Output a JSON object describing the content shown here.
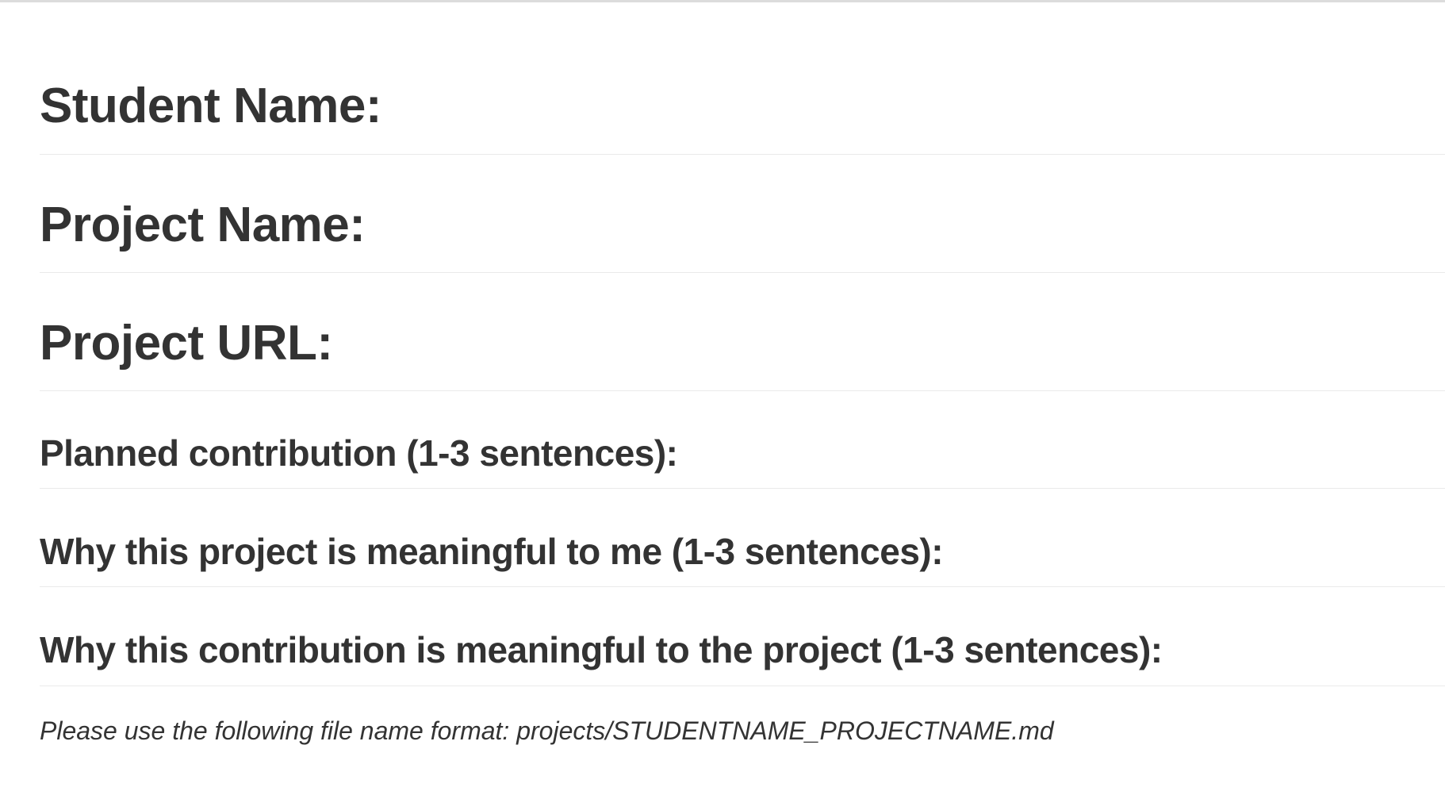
{
  "document": {
    "headings": {
      "student_name": "Student Name:",
      "project_name": "Project Name:",
      "project_url": "Project URL:",
      "planned_contribution": "Planned contribution (1-3 sentences):",
      "why_meaningful_to_me": "Why this project is meaningful to me (1-3 sentences):",
      "why_meaningful_to_project": "Why this contribution is meaningful to the project (1-3 sentences):"
    },
    "note": "Please use the following file name format: projects/STUDENTNAME_PROJECTNAME.md"
  }
}
